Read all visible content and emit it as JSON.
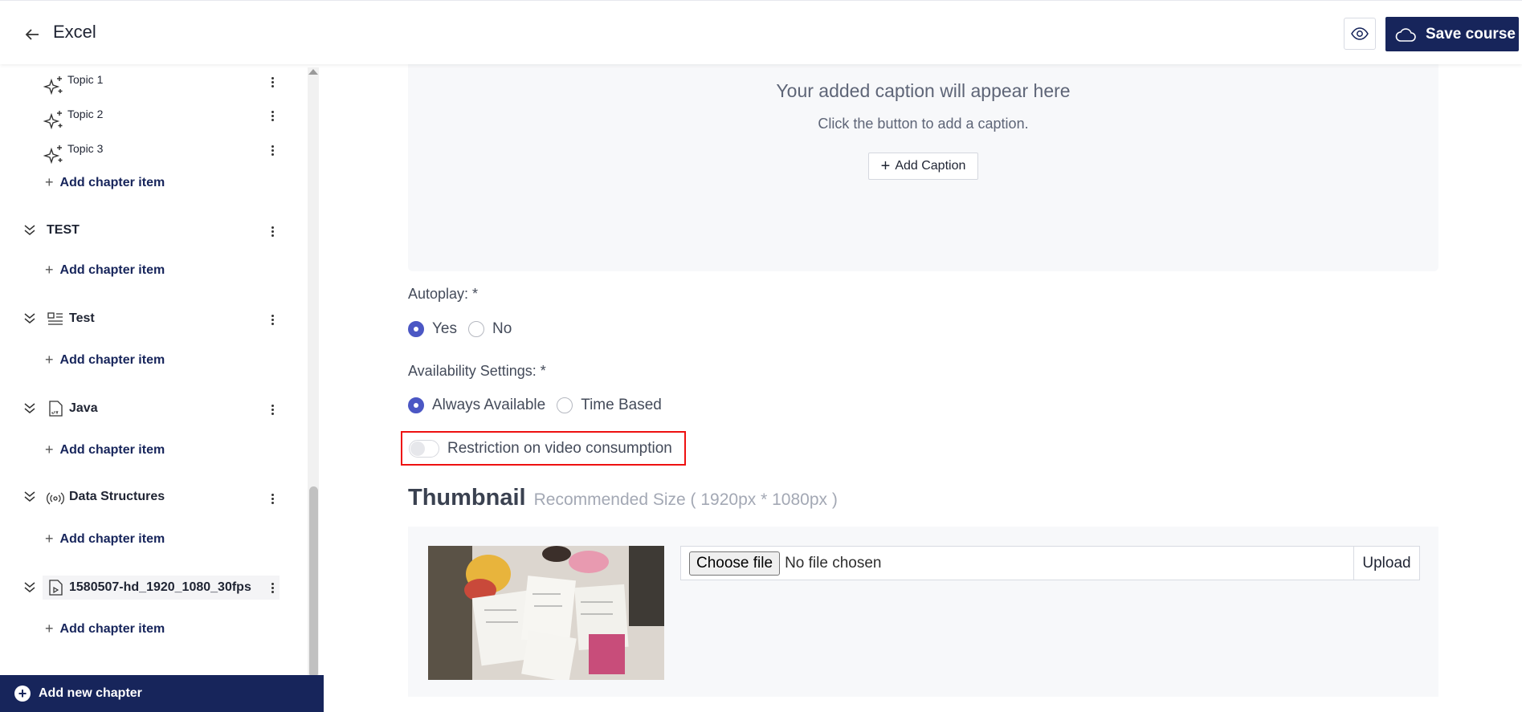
{
  "header": {
    "title": "Excel",
    "save_label": "Save course",
    "back_icon": "arrow-left-icon",
    "preview_icon": "eye-icon",
    "save_icon": "cloud-icon",
    "brand_color": "#17255b"
  },
  "sidebar": {
    "topics": [
      {
        "label": "Topic 1",
        "icon": "sparkle-icon"
      },
      {
        "label": "Topic 2",
        "icon": "sparkle-icon"
      },
      {
        "label": "Topic 3",
        "icon": "sparkle-icon"
      }
    ],
    "add_item_label": "Add chapter item",
    "chapters": [
      {
        "label": "TEST",
        "icon": ""
      },
      {
        "label": "Test",
        "icon": "document-list-icon"
      },
      {
        "label": "Java",
        "icon": "live-file-icon"
      },
      {
        "label": "Data Structures",
        "icon": "broadcast-icon"
      },
      {
        "label": "1580507-hd_1920_1080_30fps",
        "icon": "video-file-icon"
      }
    ],
    "add_chapter_label": "Add new chapter"
  },
  "caption": {
    "title": "Your added caption will appear here",
    "subtitle": "Click the button to add a caption.",
    "button_label": "Add Caption"
  },
  "autoplay": {
    "label": "Autoplay: *",
    "options": [
      "Yes",
      "No"
    ],
    "selected": "Yes"
  },
  "availability": {
    "label": "Availability Settings: *",
    "options": [
      "Always Available",
      "Time Based"
    ],
    "selected": "Always Available"
  },
  "restriction": {
    "label": "Restriction on video consumption",
    "enabled": false
  },
  "thumbnail": {
    "title": "Thumbnail",
    "hint": "Recommended Size ( 1920px * 1080px )",
    "choose_label": "Choose file",
    "file_status": "No file chosen",
    "upload_label": "Upload"
  }
}
